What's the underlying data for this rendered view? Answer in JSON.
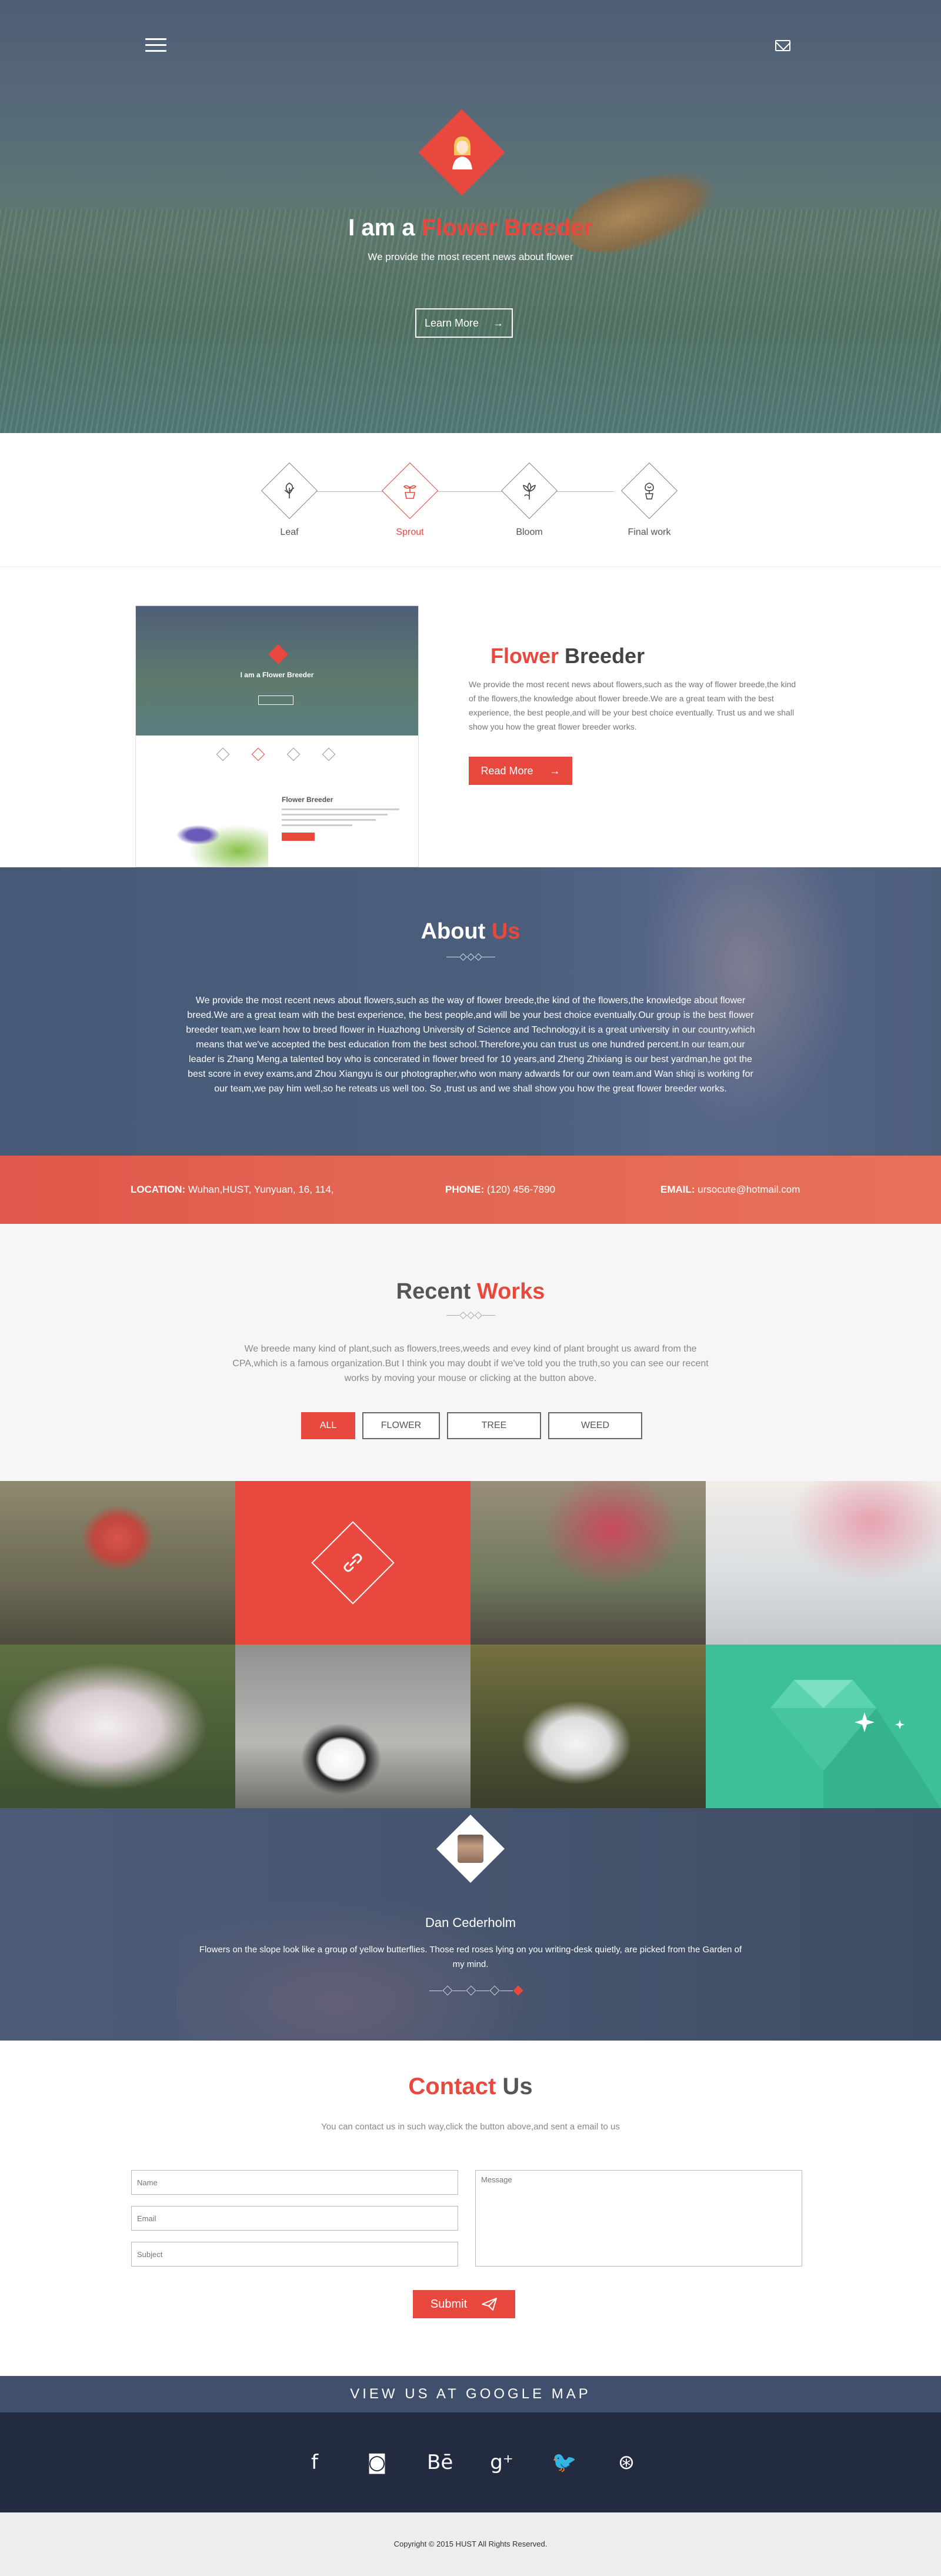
{
  "hero": {
    "title_prefix": "I am a ",
    "title_accent": "Flower Breeder",
    "subtitle": "We provide the most recent news about flower",
    "button": "Learn More",
    "button_arrow": "→"
  },
  "steps": [
    {
      "label": "Leaf",
      "icon": "leaf-icon"
    },
    {
      "label": "Sprout",
      "icon": "sprout-icon"
    },
    {
      "label": "Bloom",
      "icon": "bloom-icon"
    },
    {
      "label": "Final work",
      "icon": "final-work-icon"
    }
  ],
  "breeder": {
    "title_accent": "Flower",
    "title_rest": " Breeder",
    "text": "We provide the most recent news about flowers,such as the  way of flower breede,the kind of the flowers,the knowledge about flower breede.We are a great team with the best experience, the best people,and will be your best choice eventually. Trust us and we shall show you how the great flower breeder works.",
    "button": "Read More",
    "button_arrow": "→",
    "mock": {
      "title": "I am a Flower Breeder",
      "heading": "Flower Breeder"
    }
  },
  "about": {
    "title": "About ",
    "title_accent": "Us",
    "text": "We provide the most recent news about flowers,such as the  way of flower breede,the kind of the flowers,the knowledge about flower breed.We are a great team with the best experience, the best people,and will be your best choice eventually.Our group is the best flower breeder team,we learn how to breed flower in Huazhong University of Science and Technology,it is a great university in our country,which means that we've accepted the best education from the best school.Therefore,you can trust us one hundred percent.In our team,our leader is Zhang Meng,a talented boy who is concerated in flower breed for 10 years,and Zheng Zhixiang is our best yardman,he got the best score in evey exams,and Zhou Xiangyu is our photographer,who won many adwards for our own team.and Wan shiqi is working for our team,we pay him well,so he reteats us well too. So ,trust us and we shall show you how the great flower breeder works."
  },
  "info": {
    "location_label": "LOCATION:",
    "location": " Wuhan,HUST, Yunyuan, 16, 114,",
    "phone_label": "PHONE:",
    "phone": " (120) 456-7890",
    "email_label": "EMAIL:",
    "email": " ursocute@hotmail.com"
  },
  "works": {
    "title": "Recent ",
    "title_accent": "Works",
    "text": "We breede many kind of plant,such as flowers,trees,weeds and evey kind of plant brought us award from the CPA,which is a famous organization.But I think you may doubt if we've told you the truth,so you can see our recent works by moving your mouse or clicking at the button above.",
    "filters": [
      "ALL",
      "FLOWER",
      "TREE",
      "WEED"
    ],
    "tiles": [
      "mushroom-photo",
      "link-icon",
      "red-blossom-photo",
      "notebook-flowers-photo",
      "white-lilac-photo",
      "coffee-cup-photo",
      "dandelion-photo",
      "diamond-icon"
    ]
  },
  "testimonial": {
    "name": "Dan Cederholm",
    "quote": "Flowers on the slope look like a group of yellow butterflies. Those red roses lying on you writing-desk quietly, are picked from the Garden of my mind."
  },
  "contact": {
    "title_accent": "Contact",
    "title_rest": " Us",
    "text": "You can contact us in such way,click the button above,and sent a email to us",
    "name_placeholder": "Name",
    "email_placeholder": "Email",
    "subject_placeholder": "Subject",
    "message_placeholder": "Message",
    "submit": "Submit"
  },
  "map": {
    "label": "VIEW US AT GOOGLE MAP"
  },
  "social": [
    {
      "icon": "facebook-icon",
      "glyph": "f"
    },
    {
      "icon": "instagram-icon",
      "glyph": "◙"
    },
    {
      "icon": "behance-icon",
      "glyph": "Bē"
    },
    {
      "icon": "google-plus-icon",
      "glyph": "g⁺"
    },
    {
      "icon": "twitter-icon",
      "glyph": "🐦"
    },
    {
      "icon": "dribbble-icon",
      "glyph": "⊛"
    }
  ],
  "footer": {
    "copyright": "Copyright © 2015 HUST All Rights Reserved."
  },
  "colors": {
    "accent": "#e8483d",
    "navy": "#3f4f6c",
    "teal": "#3dbf98",
    "footer_dark": "#222b3f"
  }
}
